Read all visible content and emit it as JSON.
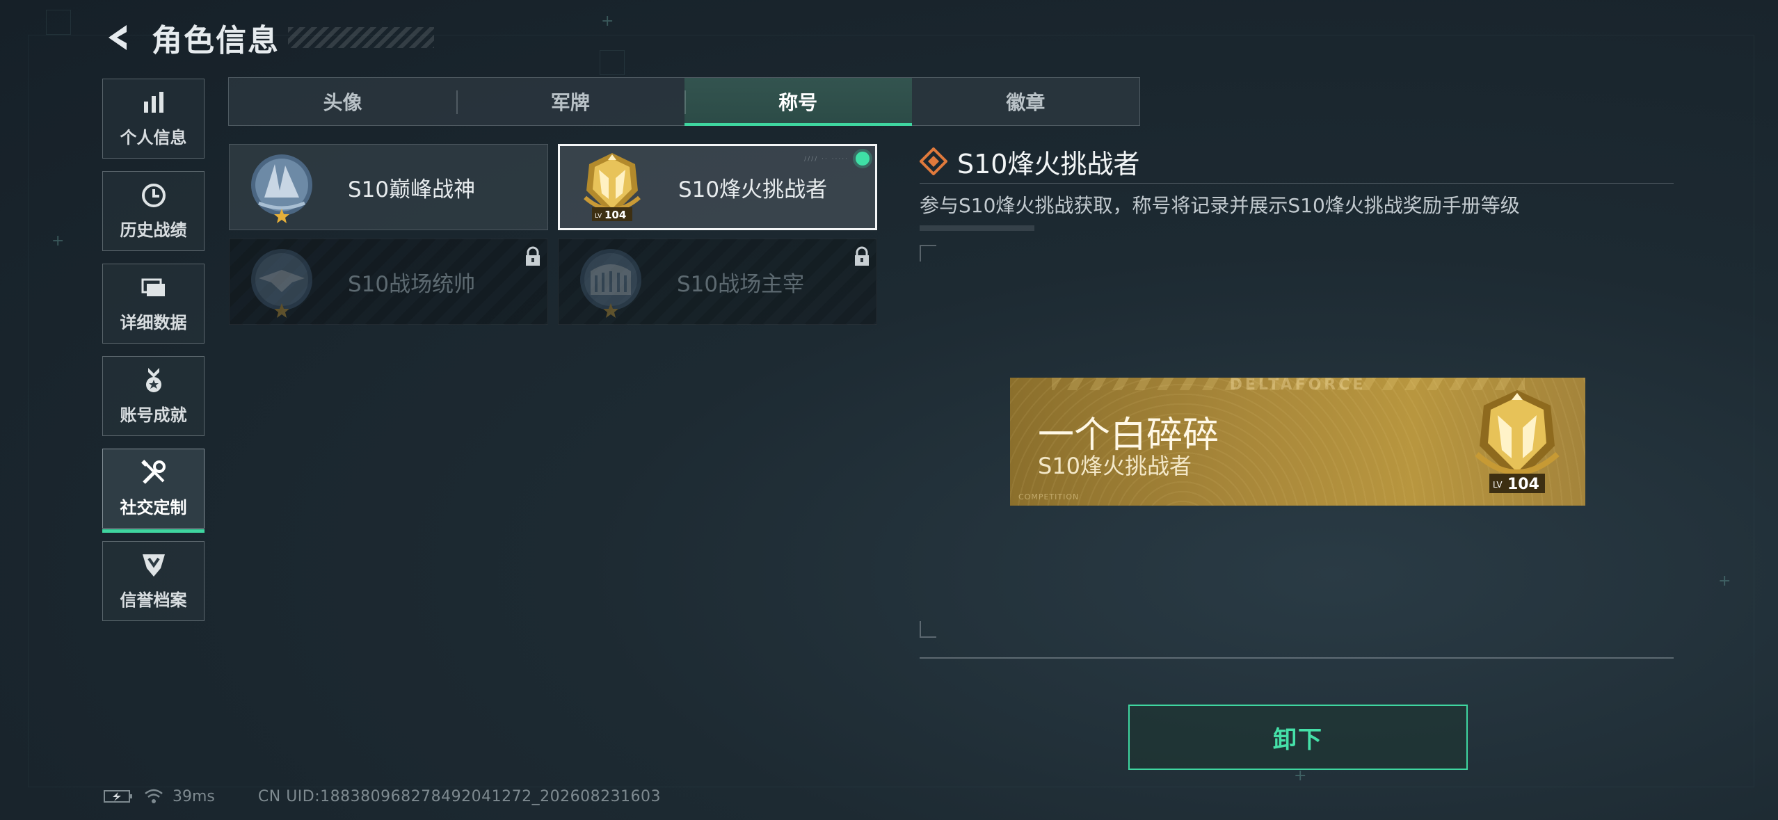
{
  "header": {
    "title": "角色信息",
    "back_icon": "back-arrow-icon"
  },
  "side_nav": {
    "items": [
      {
        "label": "个人信息",
        "icon": "bar-chart-icon",
        "active": false
      },
      {
        "label": "历史战绩",
        "icon": "clock-history-icon",
        "active": false
      },
      {
        "label": "详细数据",
        "icon": "folder-stack-icon",
        "active": false
      },
      {
        "label": "账号成就",
        "icon": "medal-icon",
        "active": false
      },
      {
        "label": "社交定制",
        "icon": "wrench-screwdriver-icon",
        "active": true
      },
      {
        "label": "信誉档案",
        "icon": "shield-chevron-icon",
        "active": false
      }
    ]
  },
  "tabs": [
    {
      "label": "头像",
      "active": false
    },
    {
      "label": "军牌",
      "active": false
    },
    {
      "label": "称号",
      "active": true
    },
    {
      "label": "徽章",
      "active": false
    }
  ],
  "title_cards": [
    {
      "name": "S10巅峰战神",
      "emblem": "peak-warrior-emblem",
      "state": "owned"
    },
    {
      "name": "S10烽火挑战者",
      "emblem": "beacon-challenger-emblem",
      "emblem_level": "104",
      "emblem_level_prefix": "LV",
      "state": "equipped"
    },
    {
      "name": "S10战场统帅",
      "emblem": "battlefield-commander-emblem",
      "state": "locked"
    },
    {
      "name": "S10战场主宰",
      "emblem": "battlefield-dominator-emblem",
      "state": "locked"
    }
  ],
  "detail": {
    "title": "S10烽火挑战者",
    "description": "参与S10烽火挑战获取，称号将记录并展示S10烽火挑战奖励手册等级",
    "icon": "diamond-cluster-icon"
  },
  "nameplate": {
    "brand": "DELTAFORCE",
    "player_name": "一个白碎碎",
    "title": "S10烽火挑战者",
    "footer": "COMPETITION",
    "level_prefix": "LV",
    "level": "104"
  },
  "actions": {
    "unequip_label": "卸下"
  },
  "status": {
    "latency": "39ms",
    "uid": "CN UID:188380968278492041272_202608231603"
  },
  "colors": {
    "accent": "#3fd6a0",
    "gold": "#b8963f",
    "background": "#1d2a32"
  }
}
